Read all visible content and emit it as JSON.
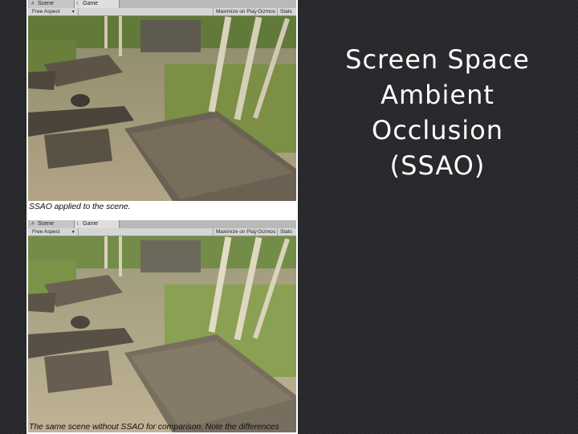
{
  "slide": {
    "title_lines": [
      "Screen Space",
      "Ambient",
      "Occlusion",
      "(SSAO)"
    ]
  },
  "screenshot_top": {
    "tabs": [
      {
        "label": "Scene",
        "icon": "scene-icon"
      },
      {
        "label": "Game",
        "icon": "game-icon"
      }
    ],
    "toolbar": {
      "aspect": "Free Aspect",
      "maximize": "Maximize on Play",
      "gizmos": "Gizmos",
      "stats": "Stats"
    },
    "caption": "SSAO applied to the scene."
  },
  "screenshot_bottom": {
    "tabs": [
      {
        "label": "Scene",
        "icon": "scene-icon"
      },
      {
        "label": "Game",
        "icon": "game-icon"
      }
    ],
    "toolbar": {
      "aspect": "Free Aspect",
      "maximize": "Maximize on Play",
      "gizmos": "Gizmos",
      "stats": "Stats"
    },
    "caption": "The same scene without SSAO for comparison. Note the differences"
  },
  "colors": {
    "background": "#2b2c2e",
    "title_text": "#ffffff",
    "ground": "#a99a7d",
    "foliage": "#6f8a3e",
    "stone": "#6b6152"
  }
}
